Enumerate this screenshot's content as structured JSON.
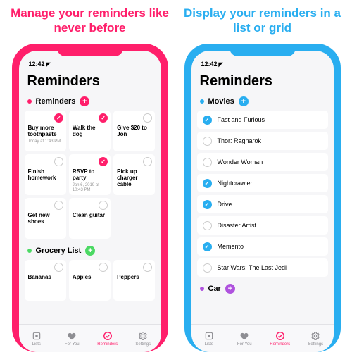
{
  "promos": [
    {
      "headline": "Manage your reminders like never before",
      "accent": "#ff1f6b",
      "statusbar": {
        "time": "12:42",
        "location_icon": "location-arrow"
      },
      "screen_title": "Reminders",
      "tabbar": [
        {
          "icon": "lists-icon",
          "label": "Lists"
        },
        {
          "icon": "foryou-icon",
          "label": "For You"
        },
        {
          "icon": "reminders-icon",
          "label": "Reminders",
          "active": true
        },
        {
          "icon": "settings-icon",
          "label": "Settings"
        }
      ],
      "sections": [
        {
          "name": "Reminders",
          "color": "#ff1f6b",
          "layout": "grid",
          "items": [
            {
              "label": "Buy more toothpaste",
              "sub": "Today at 1:43 PM",
              "done": true
            },
            {
              "label": "Walk the dog",
              "done": true
            },
            {
              "label": "Give $20 to Jon",
              "done": false
            },
            {
              "label": "Finish homework",
              "done": false
            },
            {
              "label": "RSVP to party",
              "sub": "Jan 6, 2019 at 10:43 PM",
              "done": true
            },
            {
              "label": "Pick up charger cable",
              "done": false
            },
            {
              "label": "Get new shoes",
              "done": false
            },
            {
              "label": "Clean guitar",
              "done": false
            }
          ]
        },
        {
          "name": "Grocery List",
          "color": "#4cd964",
          "layout": "grid",
          "items": [
            {
              "label": "Bananas",
              "done": false
            },
            {
              "label": "Apples",
              "done": false
            },
            {
              "label": "Peppers",
              "done": false
            }
          ]
        }
      ]
    },
    {
      "headline": "Display your reminders in a list or grid",
      "accent": "#29aef0",
      "statusbar": {
        "time": "12:42",
        "location_icon": "location-arrow"
      },
      "screen_title": "Reminders",
      "tabbar": [
        {
          "icon": "lists-icon",
          "label": "Lists"
        },
        {
          "icon": "foryou-icon",
          "label": "For You"
        },
        {
          "icon": "reminders-icon",
          "label": "Reminders",
          "active": true
        },
        {
          "icon": "settings-icon",
          "label": "Settings"
        }
      ],
      "sections": [
        {
          "name": "Movies",
          "color": "#29aef0",
          "layout": "list",
          "items": [
            {
              "label": "Fast and Furious",
              "done": true
            },
            {
              "label": "Thor: Ragnarok",
              "done": false
            },
            {
              "label": "Wonder Woman",
              "done": false
            },
            {
              "label": "Nightcrawler",
              "done": true
            },
            {
              "label": "Drive",
              "done": true
            },
            {
              "label": "Disaster Artist",
              "done": false
            },
            {
              "label": "Memento",
              "done": true
            },
            {
              "label": "Star Wars: The Last Jedi",
              "done": false
            }
          ]
        },
        {
          "name": "Car",
          "color": "#af52de",
          "layout": "list",
          "items": []
        }
      ]
    }
  ]
}
